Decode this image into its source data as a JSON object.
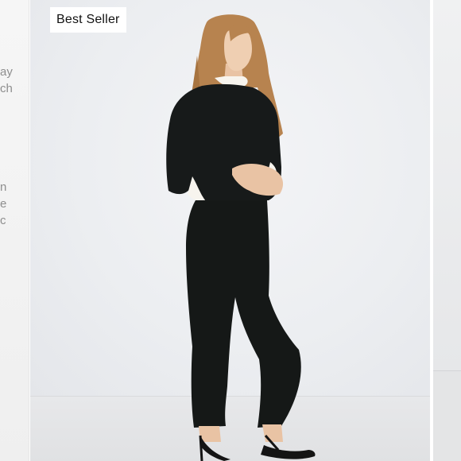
{
  "carousel": {
    "current_card": {
      "badge_label": "Best Seller",
      "image_alt": "Model in black cropped sweater with white collar, black slim pants and black strappy heels"
    },
    "previous_card": {
      "text_fragments": [
        "ay",
        "ch",
        "n",
        "e",
        "c"
      ]
    }
  }
}
